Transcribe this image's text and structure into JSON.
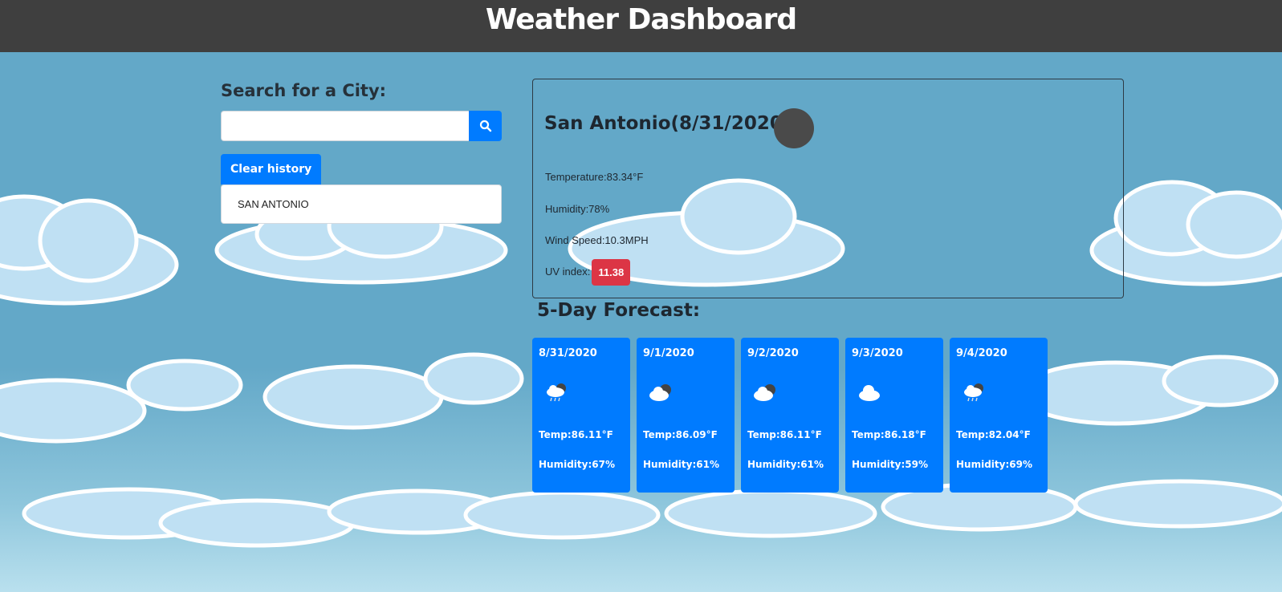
{
  "header": {
    "title": "Weather Dashboard"
  },
  "search": {
    "heading": "Search for a City:",
    "input_value": "",
    "placeholder": "",
    "button_icon": "search-icon",
    "clear_label": "Clear history",
    "history": [
      "SAN ANTONIO"
    ]
  },
  "current": {
    "title": "San Antonio(8/31/2020)",
    "icon": "weather-icon",
    "temperature": "Temperature:83.34°F",
    "humidity": "Humidity:78%",
    "wind": "Wind Speed:10.3MPH",
    "uv_label": "UV index:",
    "uv_value": "11.38",
    "uv_color": "#dc3545"
  },
  "forecast": {
    "heading": "5-Day Forecast:",
    "days": [
      {
        "date": "8/31/2020",
        "icon": "rain-cloud-icon",
        "temp": "Temp:86.11°F",
        "humidity": "Humidity:67%"
      },
      {
        "date": "9/1/2020",
        "icon": "partly-cloudy-icon",
        "temp": "Temp:86.09°F",
        "humidity": "Humidity:61%"
      },
      {
        "date": "9/2/2020",
        "icon": "partly-cloudy-icon",
        "temp": "Temp:86.11°F",
        "humidity": "Humidity:61%"
      },
      {
        "date": "9/3/2020",
        "icon": "cloud-icon",
        "temp": "Temp:86.18°F",
        "humidity": "Humidity:59%"
      },
      {
        "date": "9/4/2020",
        "icon": "rain-cloud-icon",
        "temp": "Temp:82.04°F",
        "humidity": "Humidity:69%"
      }
    ]
  },
  "colors": {
    "header_bg": "#3f3f3f",
    "accent": "#007bff",
    "sky": "#63a8c8"
  }
}
